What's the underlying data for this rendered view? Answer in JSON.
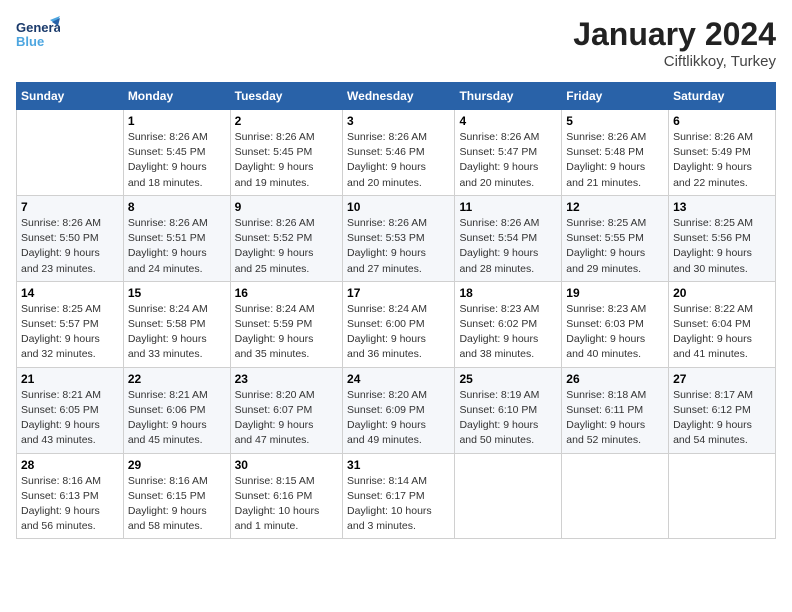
{
  "header": {
    "logo_line1": "General",
    "logo_line2": "Blue",
    "main_title": "January 2024",
    "subtitle": "Ciftlikkoy, Turkey"
  },
  "days_of_week": [
    "Sunday",
    "Monday",
    "Tuesday",
    "Wednesday",
    "Thursday",
    "Friday",
    "Saturday"
  ],
  "weeks": [
    [
      {
        "day": "",
        "detail": ""
      },
      {
        "day": "1",
        "detail": "Sunrise: 8:26 AM\nSunset: 5:45 PM\nDaylight: 9 hours\nand 18 minutes."
      },
      {
        "day": "2",
        "detail": "Sunrise: 8:26 AM\nSunset: 5:45 PM\nDaylight: 9 hours\nand 19 minutes."
      },
      {
        "day": "3",
        "detail": "Sunrise: 8:26 AM\nSunset: 5:46 PM\nDaylight: 9 hours\nand 20 minutes."
      },
      {
        "day": "4",
        "detail": "Sunrise: 8:26 AM\nSunset: 5:47 PM\nDaylight: 9 hours\nand 20 minutes."
      },
      {
        "day": "5",
        "detail": "Sunrise: 8:26 AM\nSunset: 5:48 PM\nDaylight: 9 hours\nand 21 minutes."
      },
      {
        "day": "6",
        "detail": "Sunrise: 8:26 AM\nSunset: 5:49 PM\nDaylight: 9 hours\nand 22 minutes."
      }
    ],
    [
      {
        "day": "7",
        "detail": "Sunrise: 8:26 AM\nSunset: 5:50 PM\nDaylight: 9 hours\nand 23 minutes."
      },
      {
        "day": "8",
        "detail": "Sunrise: 8:26 AM\nSunset: 5:51 PM\nDaylight: 9 hours\nand 24 minutes."
      },
      {
        "day": "9",
        "detail": "Sunrise: 8:26 AM\nSunset: 5:52 PM\nDaylight: 9 hours\nand 25 minutes."
      },
      {
        "day": "10",
        "detail": "Sunrise: 8:26 AM\nSunset: 5:53 PM\nDaylight: 9 hours\nand 27 minutes."
      },
      {
        "day": "11",
        "detail": "Sunrise: 8:26 AM\nSunset: 5:54 PM\nDaylight: 9 hours\nand 28 minutes."
      },
      {
        "day": "12",
        "detail": "Sunrise: 8:25 AM\nSunset: 5:55 PM\nDaylight: 9 hours\nand 29 minutes."
      },
      {
        "day": "13",
        "detail": "Sunrise: 8:25 AM\nSunset: 5:56 PM\nDaylight: 9 hours\nand 30 minutes."
      }
    ],
    [
      {
        "day": "14",
        "detail": "Sunrise: 8:25 AM\nSunset: 5:57 PM\nDaylight: 9 hours\nand 32 minutes."
      },
      {
        "day": "15",
        "detail": "Sunrise: 8:24 AM\nSunset: 5:58 PM\nDaylight: 9 hours\nand 33 minutes."
      },
      {
        "day": "16",
        "detail": "Sunrise: 8:24 AM\nSunset: 5:59 PM\nDaylight: 9 hours\nand 35 minutes."
      },
      {
        "day": "17",
        "detail": "Sunrise: 8:24 AM\nSunset: 6:00 PM\nDaylight: 9 hours\nand 36 minutes."
      },
      {
        "day": "18",
        "detail": "Sunrise: 8:23 AM\nSunset: 6:02 PM\nDaylight: 9 hours\nand 38 minutes."
      },
      {
        "day": "19",
        "detail": "Sunrise: 8:23 AM\nSunset: 6:03 PM\nDaylight: 9 hours\nand 40 minutes."
      },
      {
        "day": "20",
        "detail": "Sunrise: 8:22 AM\nSunset: 6:04 PM\nDaylight: 9 hours\nand 41 minutes."
      }
    ],
    [
      {
        "day": "21",
        "detail": "Sunrise: 8:21 AM\nSunset: 6:05 PM\nDaylight: 9 hours\nand 43 minutes."
      },
      {
        "day": "22",
        "detail": "Sunrise: 8:21 AM\nSunset: 6:06 PM\nDaylight: 9 hours\nand 45 minutes."
      },
      {
        "day": "23",
        "detail": "Sunrise: 8:20 AM\nSunset: 6:07 PM\nDaylight: 9 hours\nand 47 minutes."
      },
      {
        "day": "24",
        "detail": "Sunrise: 8:20 AM\nSunset: 6:09 PM\nDaylight: 9 hours\nand 49 minutes."
      },
      {
        "day": "25",
        "detail": "Sunrise: 8:19 AM\nSunset: 6:10 PM\nDaylight: 9 hours\nand 50 minutes."
      },
      {
        "day": "26",
        "detail": "Sunrise: 8:18 AM\nSunset: 6:11 PM\nDaylight: 9 hours\nand 52 minutes."
      },
      {
        "day": "27",
        "detail": "Sunrise: 8:17 AM\nSunset: 6:12 PM\nDaylight: 9 hours\nand 54 minutes."
      }
    ],
    [
      {
        "day": "28",
        "detail": "Sunrise: 8:16 AM\nSunset: 6:13 PM\nDaylight: 9 hours\nand 56 minutes."
      },
      {
        "day": "29",
        "detail": "Sunrise: 8:16 AM\nSunset: 6:15 PM\nDaylight: 9 hours\nand 58 minutes."
      },
      {
        "day": "30",
        "detail": "Sunrise: 8:15 AM\nSunset: 6:16 PM\nDaylight: 10 hours\nand 1 minute."
      },
      {
        "day": "31",
        "detail": "Sunrise: 8:14 AM\nSunset: 6:17 PM\nDaylight: 10 hours\nand 3 minutes."
      },
      {
        "day": "",
        "detail": ""
      },
      {
        "day": "",
        "detail": ""
      },
      {
        "day": "",
        "detail": ""
      }
    ]
  ]
}
